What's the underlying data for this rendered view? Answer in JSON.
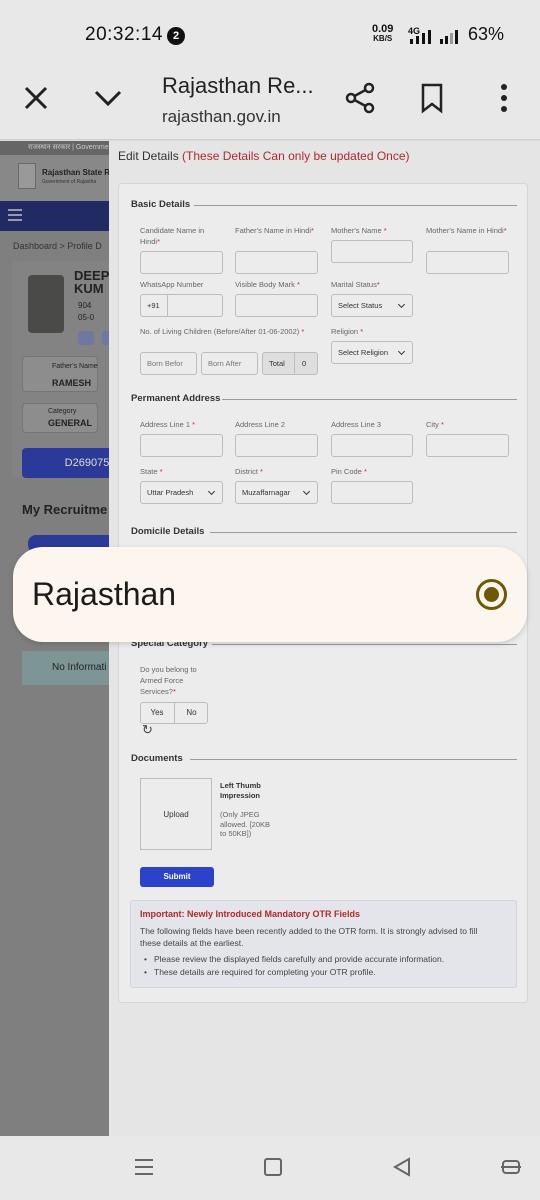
{
  "status_bar": {
    "time": "20:32:14",
    "notification_count": "2",
    "net_speed_value": "0.09",
    "net_speed_unit": "KB/S",
    "network_type": "4G",
    "battery": "63%"
  },
  "browser": {
    "title": "Rajasthan Re...",
    "url": "rajasthan.gov.in"
  },
  "background_page": {
    "top_strip": "राजस्थान सरकार | Governme",
    "header_title": "Rajasthan State R",
    "header_sub": "Government of Rajastha",
    "breadcrumb": "Dashboard  >  Profile D",
    "name": "DEEP KUM",
    "phone": "904",
    "dob": "05-0",
    "father_label": "Father's Name",
    "father_value": "RAMESH",
    "category_label": "Category",
    "category_value": "GENERAL",
    "id": "D269075",
    "recruitments": "My Recruitme",
    "no_info": "No Informati"
  },
  "form": {
    "header": "Edit Details",
    "header_warning": "(These Details Can only be updated Once)",
    "basic": {
      "title": "Basic Details",
      "name_hindi": "Candidate Name in Hindi",
      "father_hindi": "Father's Name in Hindi",
      "mother_name": "Mother's Name",
      "mother_hindi": "Mother's Name in Hindi",
      "whatsapp": "WhatsApp Number",
      "whatsapp_prefix": "+91",
      "body_mark": "Visible Body Mark",
      "marital": "Marital Status",
      "marital_value": "Select Status",
      "children": "No. of Living Children (Before/After 01-06-2002)",
      "born_before": "Born Befor",
      "born_after": "Born After",
      "total_label": "Total",
      "total_value": "0",
      "religion": "Religion",
      "religion_value": "Select Religion"
    },
    "address": {
      "title": "Permanent Address",
      "line1": "Address Line 1",
      "line2": "Address Line 2",
      "line3": "Address Line 3",
      "city": "City",
      "state": "State",
      "state_value": "Uttar Pradesh",
      "district": "District",
      "district_value": "Muzaffarnagar",
      "pin": "Pin Code"
    },
    "domicile": {
      "title": "Domicile Details"
    },
    "special": {
      "title": "Special Category",
      "armed": "Do you belong to Armed Force Services?",
      "yes": "Yes",
      "no": "No"
    },
    "documents": {
      "title": "Documents",
      "upload": "Upload",
      "thumb_label": "Left Thumb Impression",
      "thumb_hint": "(Only JPEG allowed. [20KB to 50KB])"
    },
    "submit": "Submit",
    "notice": {
      "title": "Important: Newly Introduced Mandatory OTR Fields",
      "body": "The following fields have been recently added to the OTR form. It is strongly advised to fill these details at the earliest.",
      "bullet1": "Please review the displayed fields carefully and provide accurate information.",
      "bullet2": "These details are required for completing your OTR profile."
    }
  },
  "popup": {
    "option_label": "Rajasthan",
    "selected": true
  },
  "colors": {
    "accent": "#2c43c9",
    "warning": "#b02a2a",
    "radio": "#6e5806"
  }
}
